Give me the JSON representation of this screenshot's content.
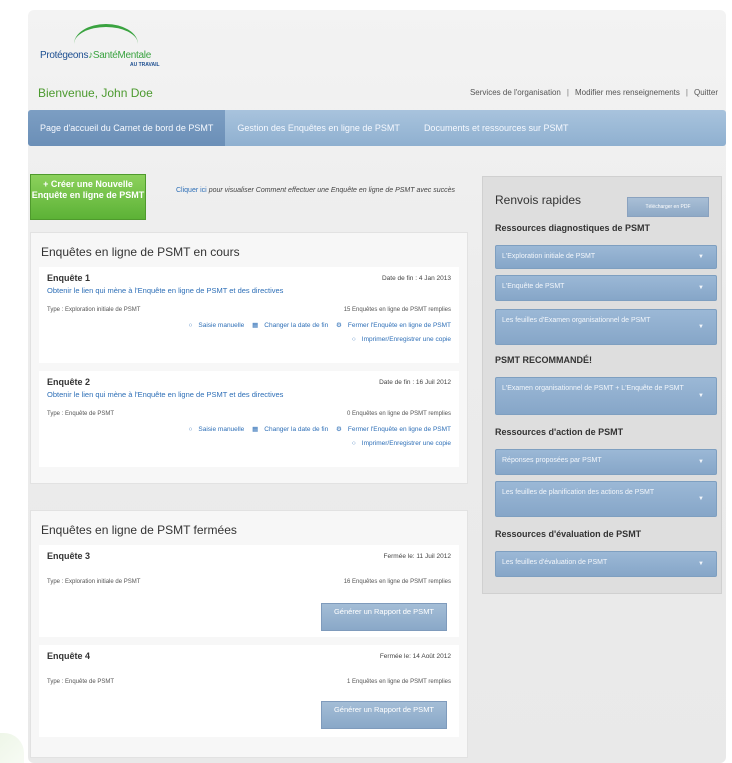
{
  "brand": {
    "logo_text_a": "Protégeons",
    "logo_text_b": "SantéMentale",
    "logo_sub": "AU TRAVAIL"
  },
  "header": {
    "welcome": "Bienvenue, John Doe",
    "links": [
      "Services de l'organisation",
      "Modifier mes renseignements",
      "Quitter"
    ]
  },
  "nav": {
    "tabs": [
      "Page d'accueil du Carnet de bord de PSMT",
      "Gestion des Enquêtes en ligne de PSMT",
      "Documents et ressources sur PSMT"
    ]
  },
  "create": {
    "plus": "+",
    "label": "Créer une Nouvelle Enquête en ligne de PSMT"
  },
  "help": {
    "link": "Cliquer ici",
    "text": "pour visualiser Comment effectuer une Enquête en ligne de PSMT avec succès"
  },
  "open_surveys": {
    "title": "Enquêtes en ligne de PSMT en cours",
    "items": [
      {
        "name": "Enquête 1",
        "end_date": "Date de fin : 4 Jan 2013",
        "link": "Obtenir le lien qui mène à l'Enquête en ligne de PSMT et des directives",
        "type": "Type : Exploration initiale de PSMT",
        "count": "15 Enquêtes en ligne de PSMT remplies",
        "actions": [
          "Saisie manuelle",
          "Changer la date de fin",
          "Fermer l'Enquête en ligne de PSMT"
        ],
        "action2": "Imprimer/Enregistrer une copie"
      },
      {
        "name": "Enquête 2",
        "end_date": "Date de fin : 16 Juil 2012",
        "link": "Obtenir le lien qui mène à l'Enquête en ligne de PSMT et des directives",
        "type": "Type : Enquête de PSMT",
        "count": "0 Enquêtes en ligne de PSMT remplies",
        "actions": [
          "Saisie manuelle",
          "Changer la date de fin",
          "Fermer l'Enquête en ligne de PSMT"
        ],
        "action2": "Imprimer/Enregistrer une copie"
      }
    ]
  },
  "closed_surveys": {
    "title": "Enquêtes en ligne de PSMT fermées",
    "items": [
      {
        "name": "Enquête 3",
        "closed": "Fermée le: 11 Juil 2012",
        "type": "Type : Exploration initiale de PSMT",
        "count": "16 Enquêtes en ligne de PSMT remplies",
        "button": "Générer un Rapport de PSMT"
      },
      {
        "name": "Enquête 4",
        "closed": "Fermée le: 14 Août 2012",
        "type": "Type : Enquête de PSMT",
        "count": "1 Enquêtes en ligne de PSMT remplies",
        "button": "Générer un Rapport de PSMT"
      }
    ]
  },
  "sidebar": {
    "title": "Renvois rapides",
    "download": "Télécharger en PDF",
    "sections": [
      {
        "heading": "Ressources diagnostiques de PSMT",
        "items": [
          "L'Exploration initiale de PSMT",
          "L'Enquête de PSMT",
          "Les feuilles d'Examen organisationnel de PSMT"
        ]
      },
      {
        "heading": "PSMT RECOMMANDÉ!",
        "items": [
          "L'Examen organisationnel de PSMT + L'Enquête de PSMT"
        ]
      },
      {
        "heading": "Ressources d'action de PSMT",
        "items": [
          "Réponses proposées par PSMT",
          "Les feuilles de planification des actions de PSMT"
        ]
      },
      {
        "heading": "Ressources d'évaluation de PSMT",
        "items": [
          "Les feuilles d'évaluation de PSMT"
        ]
      }
    ],
    "arrow_glyph": "▼"
  },
  "icons": {
    "manual": "circle-icon",
    "calendar": "calendar-icon",
    "close": "gear-icon",
    "print": "circle-icon"
  },
  "colors": {
    "accent_green": "#5cb236",
    "nav_blue": "#8fb0d0",
    "link_blue": "#2e6fb7"
  }
}
